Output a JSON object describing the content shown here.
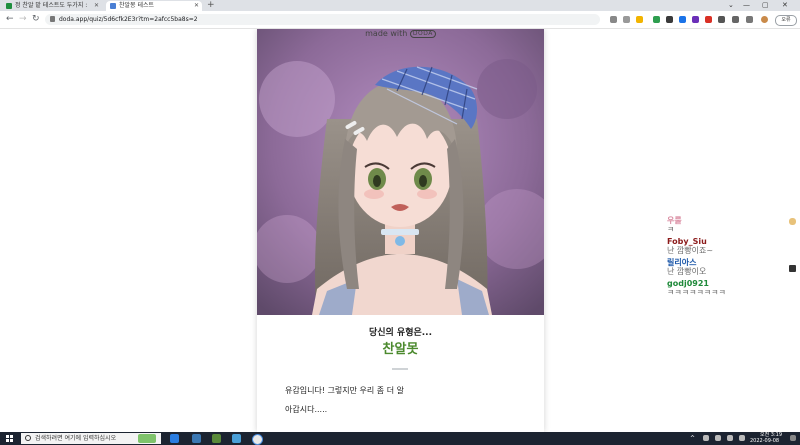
{
  "browser": {
    "tabs": [
      {
        "label": "정 찬알 밭 테스트도 두가지 : 네",
        "favicon_color": "#1e8e3e"
      },
      {
        "label": "찬알몽 테스트",
        "favicon_color": "#4a7fd4"
      }
    ],
    "new_tab": "+",
    "url": "doda.app/quiz/5d6cfk2E3r?tm=2afcc5ba8s=2",
    "profile_label": "오류"
  },
  "page": {
    "made_with": "made with",
    "brand": "DODA",
    "result_heading": "당신의 유형은...",
    "result_name": "찬알못",
    "description_lines": [
      "유감입니다! 그렇지만 우리 좀 더 알",
      "아갑시다....."
    ]
  },
  "chat": [
    {
      "user": "우룰",
      "message": "ㅋ",
      "color": "#d98aa0"
    },
    {
      "user": "Foby_Siu",
      "message": "난 깜빵이죠~",
      "color": "#8b1a1a"
    },
    {
      "user": "릴리아스",
      "message": "난 깜빵이오",
      "color": "#1a56a8"
    },
    {
      "user": "godj0921",
      "message": "ㅋㅋㅋㅋㅋㅋㅋㅋ",
      "color": "#1f8a3a"
    }
  ],
  "taskbar": {
    "search_placeholder": "검색하려면 여기에 입력하십시오",
    "time": "오전 3:19",
    "date": "2022-09-08"
  },
  "colors": {
    "accent_green": "#4c8a2e",
    "taskbar": "#1c2431"
  }
}
